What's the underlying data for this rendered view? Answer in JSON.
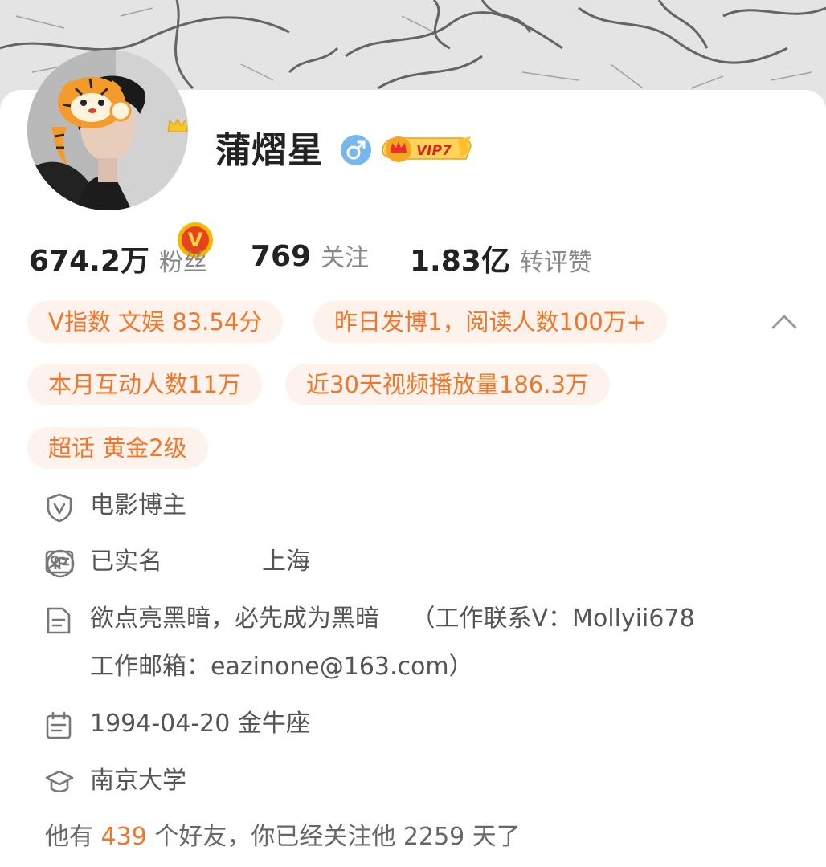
{
  "profile": {
    "name": "蒲熠星",
    "vip_level": "VIP7",
    "verified_mark": "V"
  },
  "stats": [
    {
      "value": "674.2万",
      "label": "粉丝"
    },
    {
      "value": "769",
      "label": "关注"
    },
    {
      "value": "1.83亿",
      "label": "转评赞"
    }
  ],
  "tags": [
    "V指数 文娱 83.54分",
    "昨日发博1，阅读人数100万+",
    "本月互动人数11万",
    "近30天视频播放量186.3万",
    "超话 黄金2级"
  ],
  "info": {
    "category": "电影博主",
    "realname": "已实名",
    "ip_location": "上海",
    "bio_line1": "欲点亮黑暗，必先成为黑暗　 （工作联系V：Mollyii678",
    "bio_line2": "工作邮箱：eazinone@163.com）",
    "birthday": "1994-04-20 金牛座",
    "school": "南京大学"
  },
  "friends": {
    "prefix": "他有",
    "count": "439",
    "suffix": "个好友，你已经关注他 2259 天了"
  },
  "icons": {
    "collapse": "chevron-up-icon",
    "gender": "male-icon",
    "category": "shield-v-icon",
    "realname": "id-card-icon",
    "ip": "ip-icon",
    "bio": "document-icon",
    "birthday": "calendar-icon",
    "school": "graduation-cap-icon"
  },
  "colors": {
    "accent": "#f1762a",
    "chip_bg": "#fef3ec",
    "gender_badge": "#78b7ee"
  }
}
